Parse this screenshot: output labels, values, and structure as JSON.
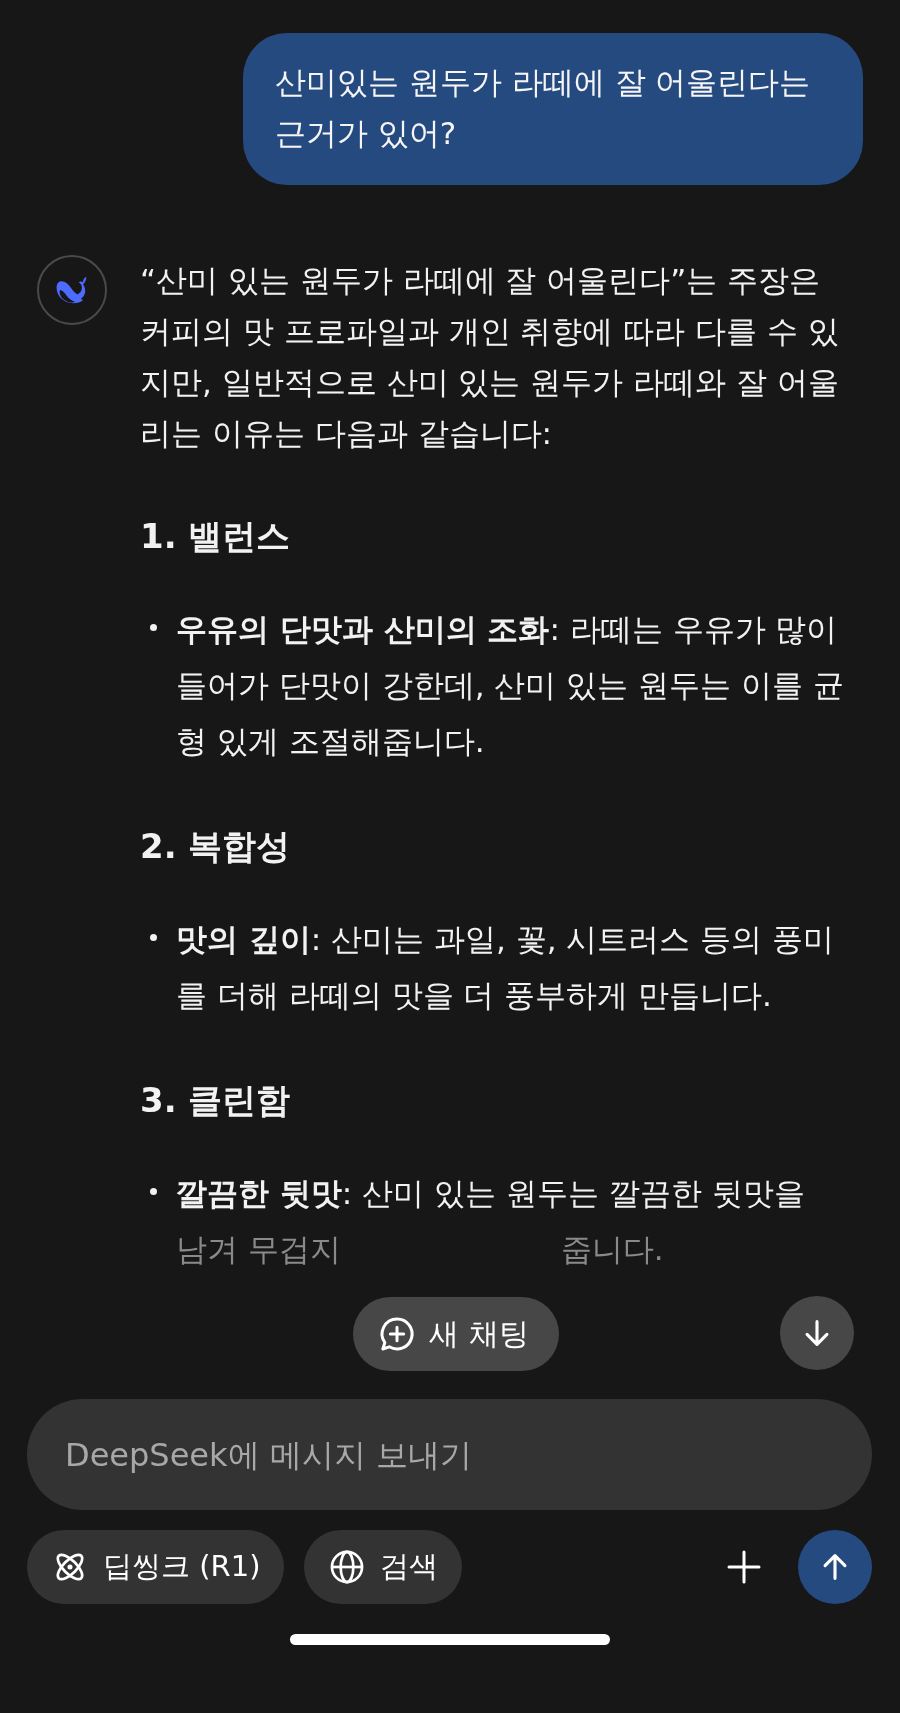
{
  "user_message": "산미있는 원두가 라떼에 잘 어울린다는 근거가 있어?",
  "assistant": {
    "intro": "“산미 있는 원두가 라떼에 잘 어울린다”는 주장은 커피의 맛 프로파일과 개인 취향에 따라 다를 수 있지만, 일반적으로 산미 있는 원두가 라떼와 잘 어울리는 이유는 다음과 같습니다:",
    "sections": [
      {
        "heading": "1. 밸런스",
        "bullets": [
          {
            "text": "**우유의 단맛과 산미의 조화**: 라떼는 우유가 많이 들어가 단맛이 강한데, 산미 있는 원두는 이를 균형 있게 조절해줍니다."
          }
        ]
      },
      {
        "heading": "2. 복합성",
        "bullets": [
          {
            "text": "**맛의 깊이**: 산미는 과일, 꽃, 시트러스 등의 풍미를 더해 라떼의 맛을 더 풍부하게 만듭니다."
          }
        ]
      },
      {
        "heading": "3. 클린함",
        "bullets": [
          {
            "text": "**깔끔한 뒷맛**: 산미 있는 원두는 깔끔한 뒷맛을",
            "faded_parts": [
              "남겨 무겁지",
              "줍니다."
            ]
          }
        ]
      }
    ]
  },
  "new_chat_button": "새 채팅",
  "composer": {
    "placeholder": "DeepSeek에 메시지 보내기",
    "chips": [
      {
        "kind": "deepthink",
        "label": "딥씽크 (R1)",
        "selected": false
      },
      {
        "kind": "search",
        "label": "검색",
        "selected": false
      }
    ]
  }
}
